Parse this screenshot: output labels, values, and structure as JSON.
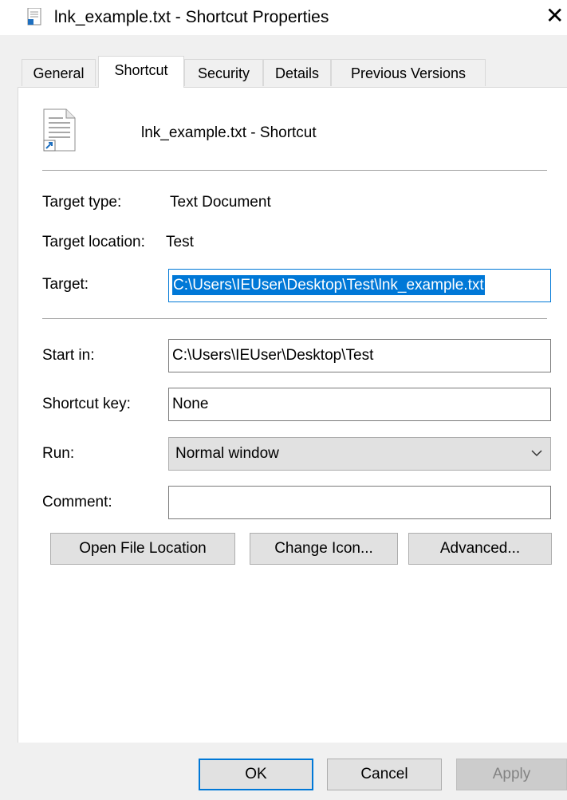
{
  "window": {
    "title": "lnk_example.txt - Shortcut Properties",
    "close_glyph": "✕"
  },
  "tabs": [
    {
      "label": "General",
      "active": false
    },
    {
      "label": "Shortcut",
      "active": true
    },
    {
      "label": "Security",
      "active": false
    },
    {
      "label": "Details",
      "active": false
    },
    {
      "label": "Previous Versions",
      "active": false
    }
  ],
  "shortcut": {
    "name": "lnk_example.txt - Shortcut",
    "target_type_label": "Target type:",
    "target_type_value": "Text Document",
    "target_location_label": "Target location:",
    "target_location_value": "Test",
    "target_label": "Target:",
    "target_value": "C:\\Users\\IEUser\\Desktop\\Test\\lnk_example.txt",
    "start_in_label": "Start in:",
    "start_in_value": "C:\\Users\\IEUser\\Desktop\\Test",
    "shortcut_key_label": "Shortcut key:",
    "shortcut_key_value": "None",
    "run_label": "Run:",
    "run_value": "Normal window",
    "comment_label": "Comment:",
    "comment_value": ""
  },
  "actions": {
    "open_file_location": "Open File Location",
    "change_icon": "Change Icon...",
    "advanced": "Advanced..."
  },
  "footer": {
    "ok": "OK",
    "cancel": "Cancel",
    "apply": "Apply"
  },
  "colors": {
    "accent": "#0078d7",
    "panel_bg": "#ffffff",
    "window_bg": "#f0f0f0"
  }
}
